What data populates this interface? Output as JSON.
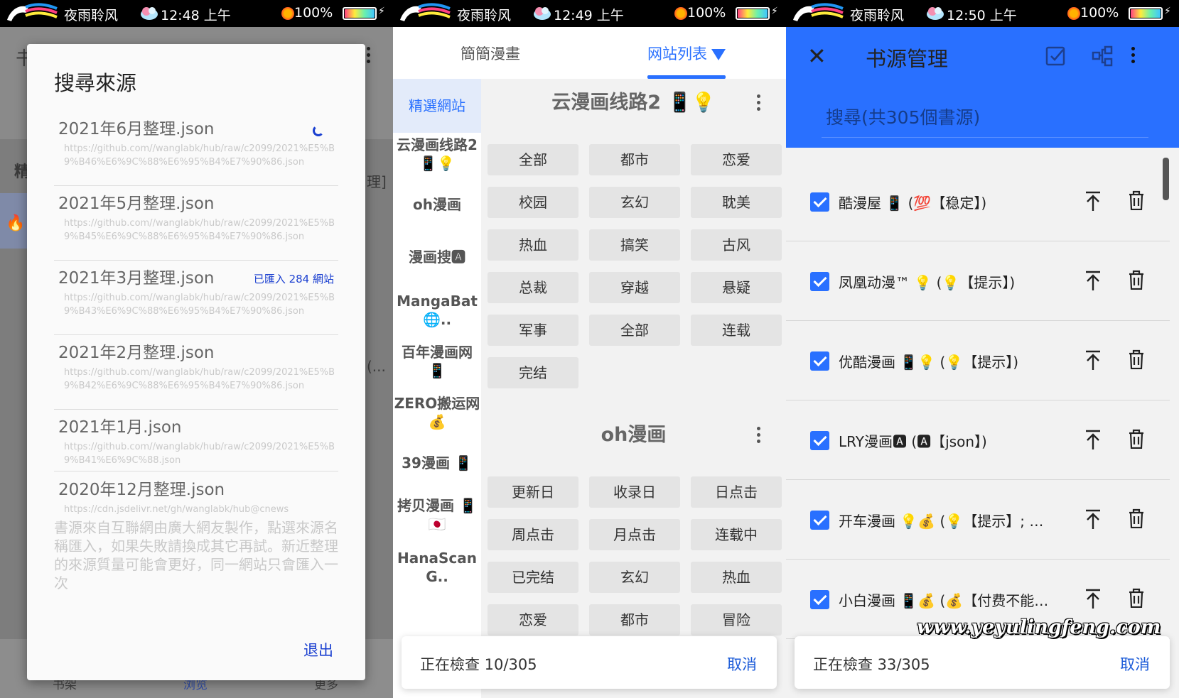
{
  "status_bars": [
    {
      "name": "夜雨聆风",
      "time": "12:48 上午",
      "battery": "100%"
    },
    {
      "name": "夜雨聆风",
      "time": "12:49 上午",
      "battery": "100%"
    },
    {
      "name": "夜雨聆风",
      "time": "12:50 上午",
      "battery": "100%"
    }
  ],
  "panel1": {
    "bg_fragments": [
      "书",
      "精",
      "理]",
      "...",
      "(..."
    ],
    "bg_nav": [
      "书架",
      "浏览",
      "更多"
    ],
    "dialog": {
      "title": "搜尋來源",
      "items": [
        {
          "name": "2021年6月整理.json",
          "url": "https://github.com//wanglabk/hub/raw/c2099/2021%E5%B9%B46%E6%9C%88%E6%95%B4%E7%90%86.json",
          "loading": true
        },
        {
          "name": "2021年5月整理.json",
          "url": "https://github.com//wanglabk/hub/raw/c2099/2021%E5%B9%B45%E6%9C%88%E6%95%B4%E7%90%86.json"
        },
        {
          "name": "2021年3月整理.json",
          "url": "https://github.com//wanglabk/hub/raw/c2099/2021%E5%B9%B43%E6%9C%88%E6%95%B4%E7%90%86.json",
          "badge": "已匯入 284 網站"
        },
        {
          "name": "2021年2月整理.json",
          "url": "https://github.com//wanglabk/hub/raw/c2099/2021%E5%B9%B42%E6%9C%88%E6%95%B4%E7%90%86.json"
        },
        {
          "name": "2021年1月.json",
          "url": "https://github.com//wanglabk/hub/raw/c2099/2021%E5%B9%B41%E6%9C%88.json"
        },
        {
          "name": "2020年12月整理.json",
          "url": "https://cdn.jsdelivr.net/gh/wanglabk/hub@cnews"
        }
      ],
      "note": "書源來自互聯網由廣大網友製作，點選來源名稱匯入，如果失敗請換成其它再試。新近整理的來源質量可能會更好，同一網站只會匯入一次",
      "exit_label": "退出"
    }
  },
  "panel2": {
    "tabs": [
      "簡簡漫畫",
      "网站列表"
    ],
    "sidebar": [
      "精選網站",
      "云漫画线路2 📱💡",
      "oh漫画",
      "漫画搜🅰",
      "MangaBat 🌐..",
      "百年漫画网 📱",
      "ZERO搬运网 💰",
      "39漫画 📱",
      "拷贝漫画 📱🇯🇵",
      "HanaScan G.."
    ],
    "sections": [
      {
        "title": "云漫画线路2 📱💡",
        "buttons": [
          "全部",
          "都市",
          "恋爱",
          "校园",
          "玄幻",
          "耽美",
          "热血",
          "搞笑",
          "古风",
          "总裁",
          "穿越",
          "悬疑",
          "军事",
          "全部",
          "连载",
          "完结"
        ]
      },
      {
        "title": "oh漫画",
        "buttons": [
          "更新日",
          "收录日",
          "日点击",
          "周点击",
          "月点击",
          "连载中",
          "已完结",
          "玄幻",
          "热血",
          "恋爱",
          "都市",
          "冒险"
        ]
      }
    ],
    "progress": {
      "text": "正在檢查 10/305",
      "cancel": "取消"
    }
  },
  "panel3": {
    "title": "书源管理",
    "search_placeholder": "搜尋(共305個書源)",
    "rows": [
      {
        "label": "酷漫屋 📱 (💯【稳定】)"
      },
      {
        "label": "凤凰动漫™ 💡 (💡【提示】)"
      },
      {
        "label": "优酷漫画 📱💡 (💡【提示】)"
      },
      {
        "label": "LRY漫画🅰 (🅰【json】)"
      },
      {
        "label": "开车漫画 💡💰 (💡【提示】; 💰【付费】)"
      },
      {
        "label": "小白漫画 📱💰 (💰【付费不能看】)"
      }
    ],
    "progress": {
      "text": "正在檢查 33/305",
      "cancel": "取消"
    },
    "watermark": "www.yeyulingfeng.com"
  }
}
